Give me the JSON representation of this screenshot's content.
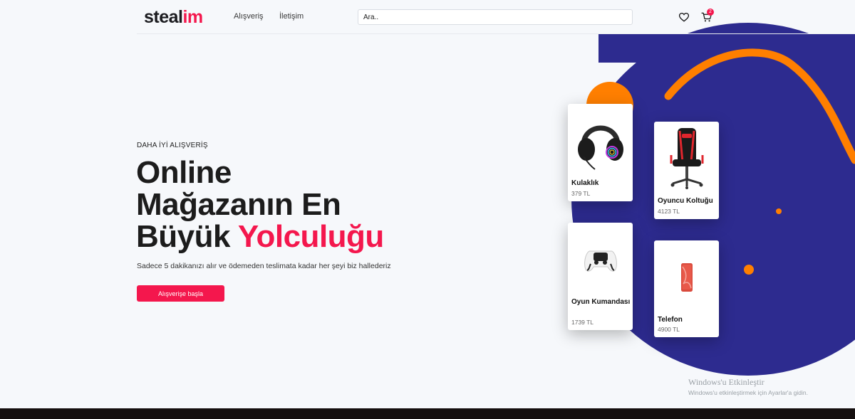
{
  "header": {
    "logo": {
      "part1": "steal",
      "part2": "im"
    },
    "nav": [
      {
        "label": "Alışveriş"
      },
      {
        "label": "İletişim"
      }
    ],
    "search": {
      "placeholder": "Ara.."
    },
    "cart_count": "2",
    "icons": {
      "favorites": "heart-icon",
      "cart": "cart-icon"
    }
  },
  "hero": {
    "eyebrow": "DAHA İYİ ALIŞVERİŞ",
    "headline_line1": "Online",
    "headline_line2": "Mağazanın En",
    "headline_line3_plain": "Büyük ",
    "headline_line3_highlight": "Yolculuğu",
    "subtitle": "Sadece 5 dakikanızı alır ve ödemeden teslimata kadar her şeyi biz hallederiz",
    "cta": "Alışverişe başla"
  },
  "products": [
    {
      "name": "Kulaklık",
      "price": "379 TL",
      "icon": "headset-icon"
    },
    {
      "name": "Oyuncu Koltuğu",
      "price": "4123 TL",
      "icon": "gaming-chair-icon"
    },
    {
      "name": "Oyun Kumandası",
      "price": "1739 TL",
      "icon": "gamepad-icon"
    },
    {
      "name": "Telefon",
      "price": "4900 TL",
      "icon": "phone-icon"
    }
  ],
  "watermark": {
    "title": "Windows'u Etkinleştir",
    "subtitle": "Windows'u etkinleştirmek için Ayarlar'a gidin."
  },
  "colors": {
    "accent": "#f4174d",
    "navy": "#2d2b8f",
    "orange": "#ff7f00"
  }
}
